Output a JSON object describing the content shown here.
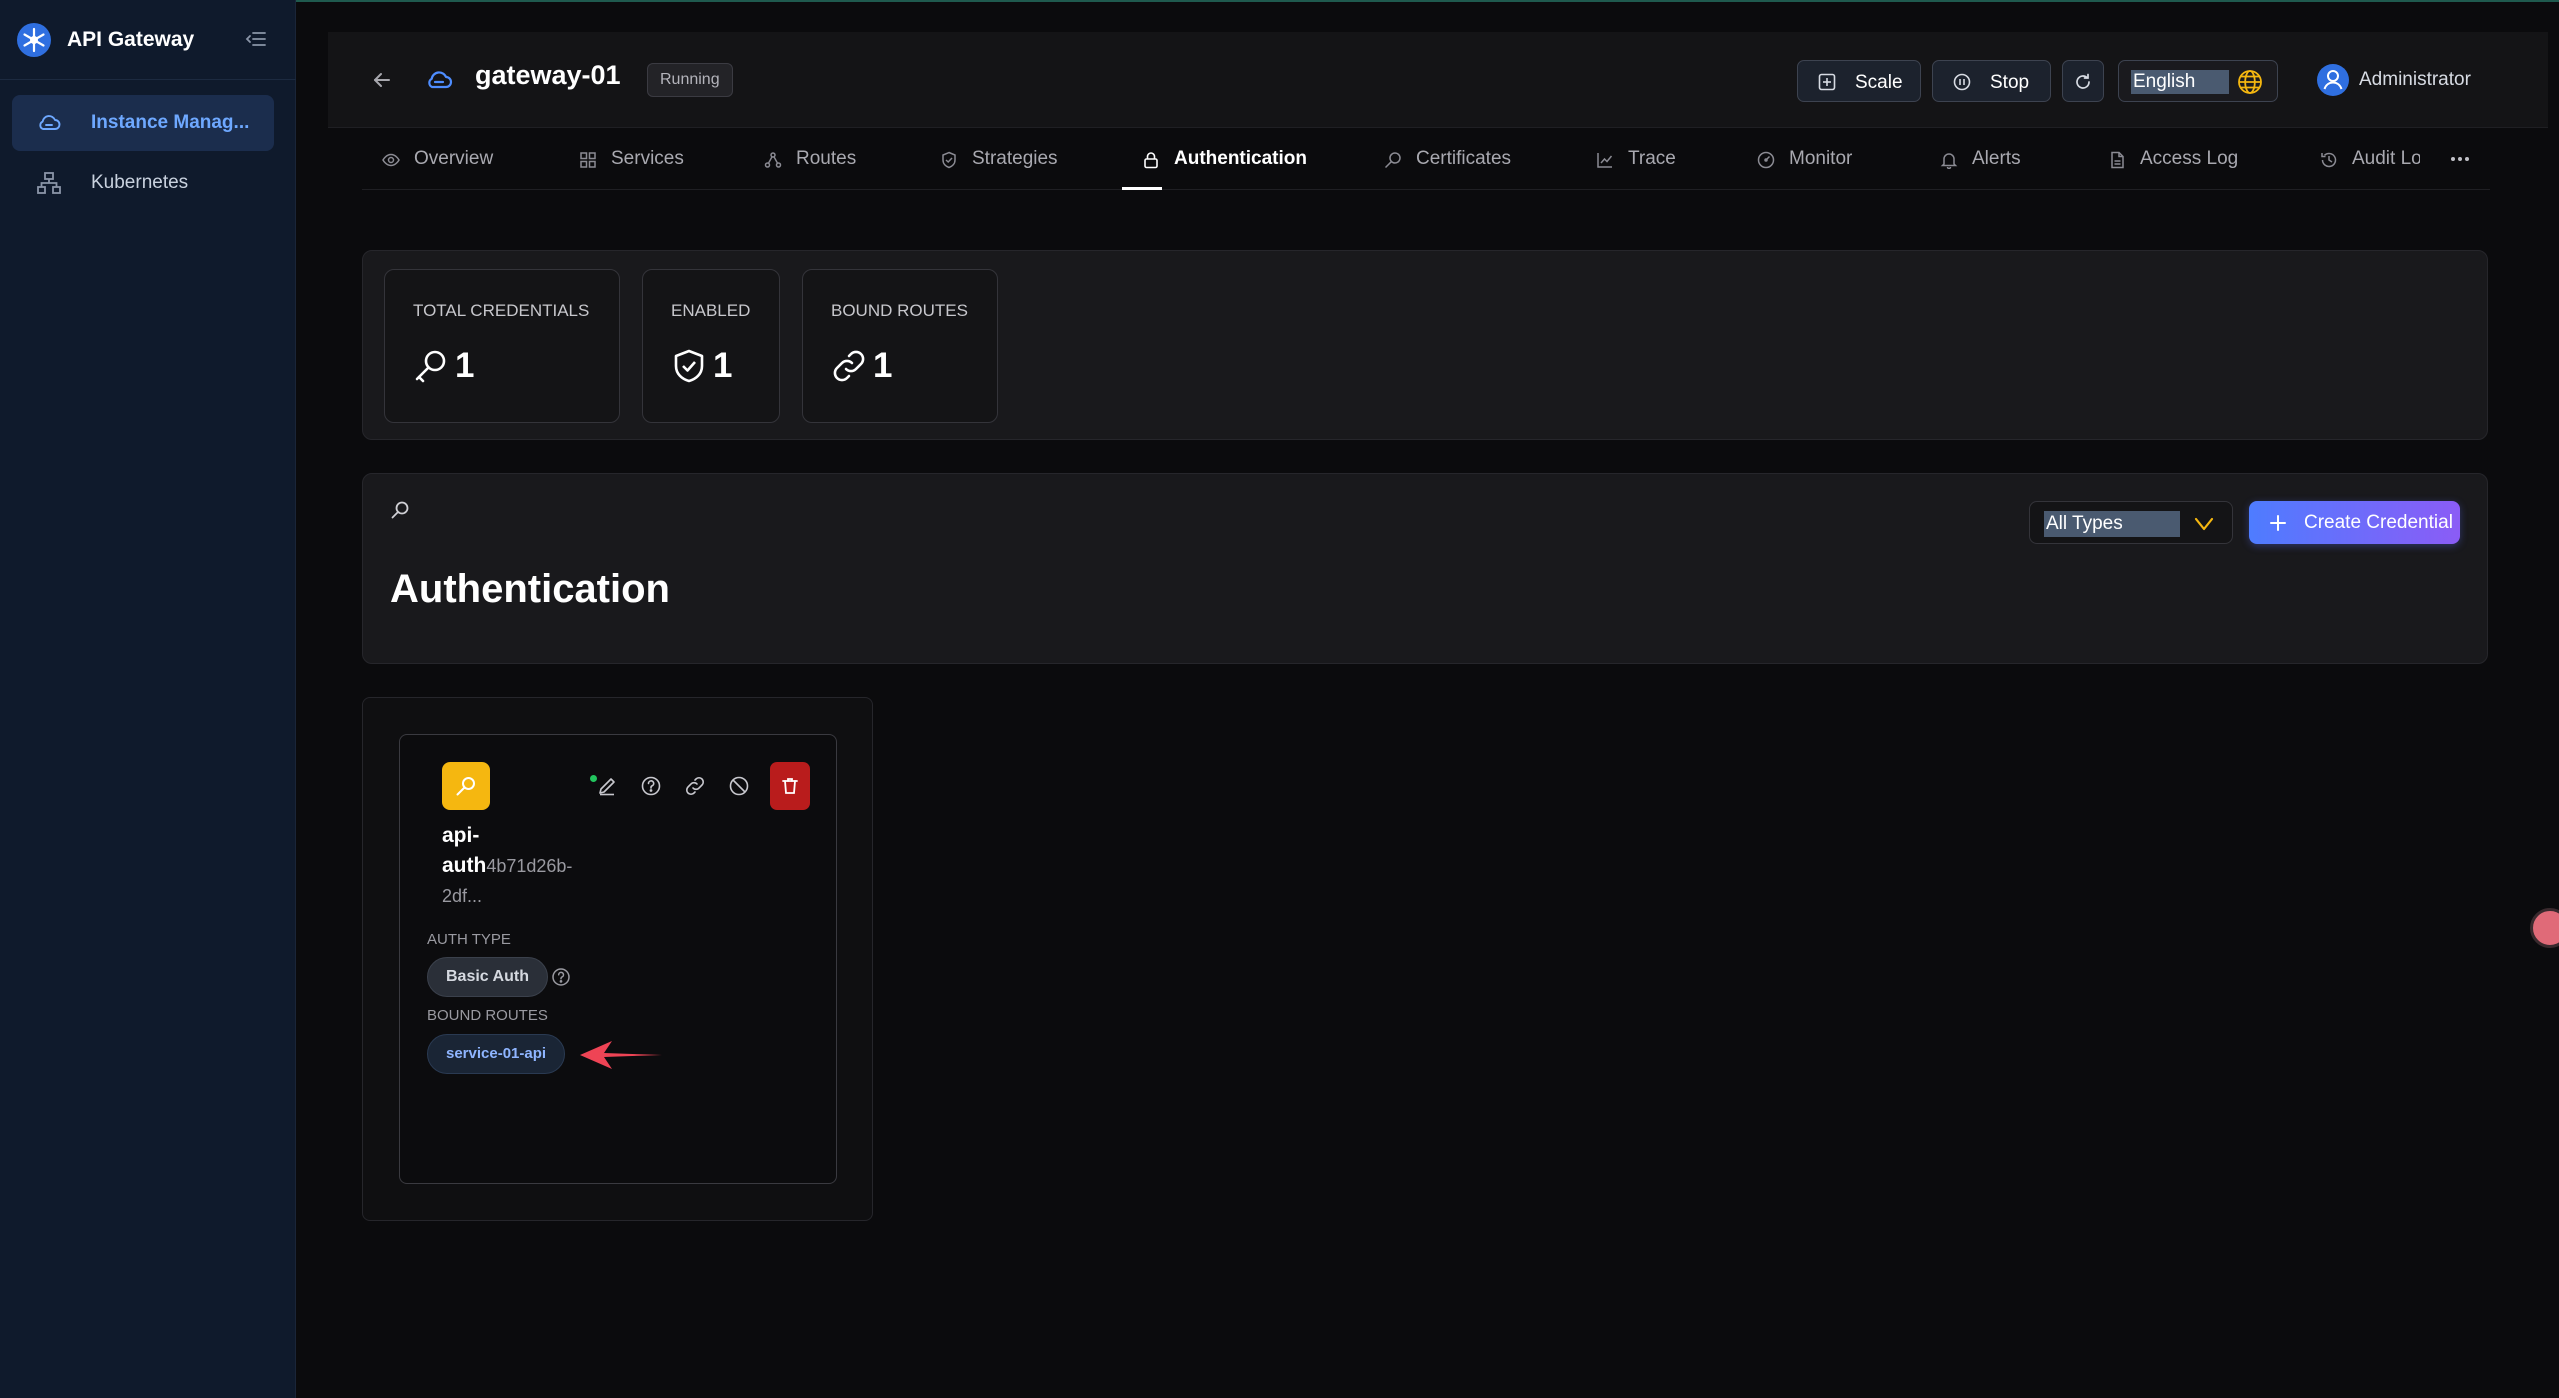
{
  "app": {
    "title": "API Gateway"
  },
  "sidebar": {
    "items": [
      {
        "label": "Instance Manag...",
        "icon": "cloud-icon",
        "active": true
      },
      {
        "label": "Kubernetes",
        "icon": "sitemap-icon",
        "active": false
      }
    ]
  },
  "header": {
    "gateway_name": "gateway-01",
    "status": "Running",
    "buttons": {
      "scale": "Scale",
      "stop": "Stop"
    },
    "language": "English",
    "user": "Administrator"
  },
  "tabs": [
    {
      "label": "Overview",
      "icon": "eye-icon"
    },
    {
      "label": "Services",
      "icon": "grid-icon"
    },
    {
      "label": "Routes",
      "icon": "routes-icon"
    },
    {
      "label": "Strategies",
      "icon": "shield-icon"
    },
    {
      "label": "Authentication",
      "icon": "lock-icon",
      "active": true
    },
    {
      "label": "Certificates",
      "icon": "key-icon"
    },
    {
      "label": "Trace",
      "icon": "chart-line-icon"
    },
    {
      "label": "Monitor",
      "icon": "gauge-icon"
    },
    {
      "label": "Alerts",
      "icon": "bell-icon"
    },
    {
      "label": "Access Log",
      "icon": "file-icon"
    },
    {
      "label": "Audit Log",
      "icon": "history-icon"
    }
  ],
  "stats": [
    {
      "label": "Total Credentials",
      "value": "1",
      "icon": "key-icon"
    },
    {
      "label": "Enabled",
      "value": "1",
      "icon": "shield-check-icon"
    },
    {
      "label": "Bound Routes",
      "value": "1",
      "icon": "link-icon"
    }
  ],
  "auth": {
    "title": "Authentication",
    "type_filter": "All Types",
    "create_label": "Create Credential"
  },
  "credential": {
    "name": "api-auth",
    "id": "4b71d26b-2df...",
    "auth_type_label": "Auth Type",
    "auth_type": "Basic Auth",
    "bound_routes_label": "Bound Routes",
    "routes": [
      "service-01-api"
    ]
  },
  "colors": {
    "accent": "#4e7cff",
    "active_nav": "#6ea8ff",
    "credential_icon": "#f5b710",
    "danger": "#b91c1c",
    "enabled_dot": "#22c55e"
  }
}
